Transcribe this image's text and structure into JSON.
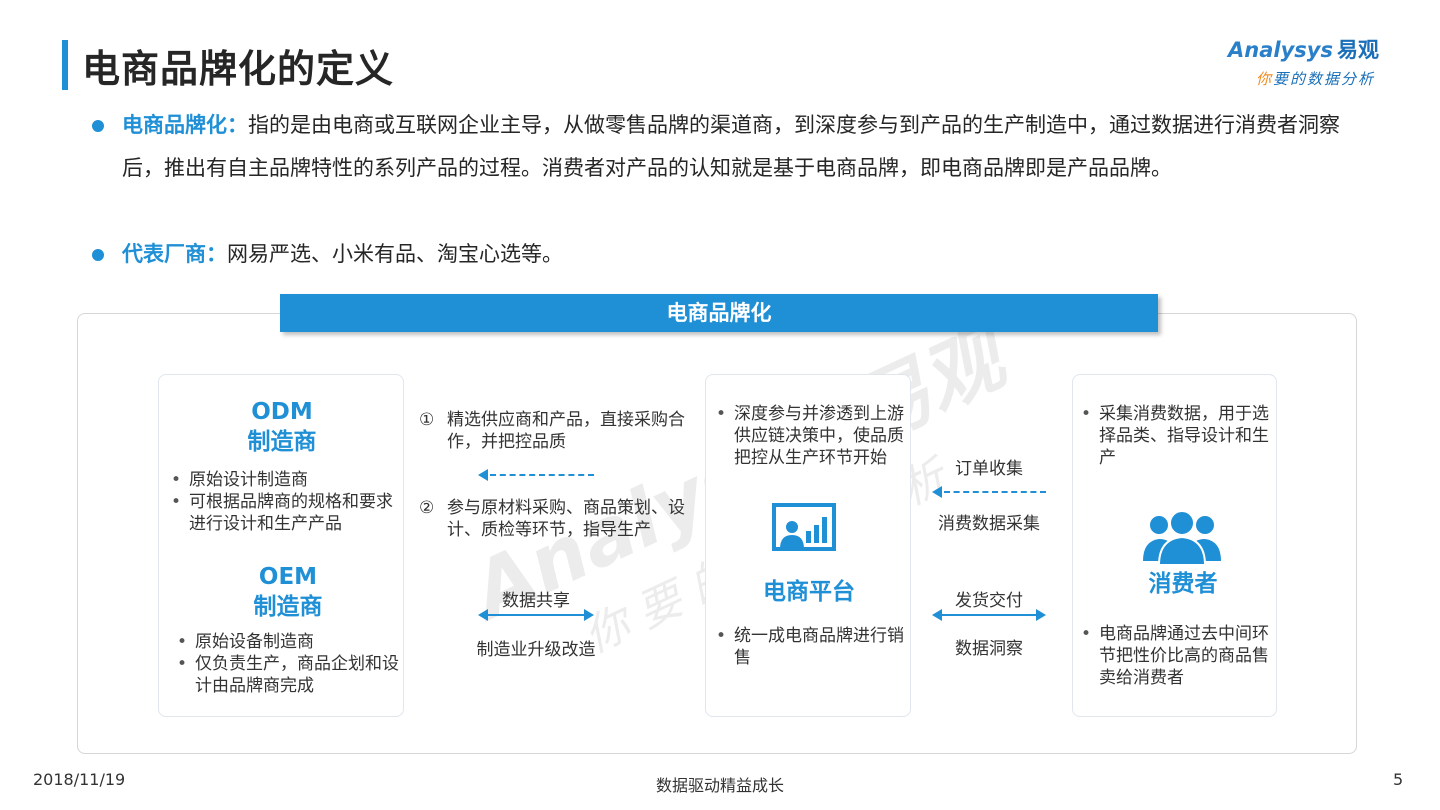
{
  "page_title": "电商品牌化的定义",
  "logo": {
    "brand_en": "Analysys",
    "brand_cn": "易观",
    "slogan_highlight": "你",
    "slogan_rest": "要的数据分析"
  },
  "bullets": [
    {
      "key": "电商品牌化：",
      "text": "指的是由电商或互联网企业主导，从做零售品牌的渠道商，到深度参与到产品的生产制造中，通过数据进行消费者洞察后，推出有自主品牌特性的系列产品的过程。消费者对产品的认知就是基于电商品牌，即电商品牌即是产品品牌。"
    },
    {
      "key": "代表厂商：",
      "text": "网易严选、小米有品、淘宝心选等。"
    }
  ],
  "banner": "电商品牌化",
  "manufacturers": {
    "odm_heading_line1": "ODM",
    "odm_heading_line2": "制造商",
    "odm_items": [
      "原始设计制造商",
      "可根据品牌商的规格和要求进行设计和生产产品"
    ],
    "oem_heading_line1": "OEM",
    "oem_heading_line2": "制造商",
    "oem_items": [
      "原始设备制造商",
      "仅负责生产，商品企划和设计由品牌商完成"
    ]
  },
  "middle_left": {
    "step1_num": "①",
    "step1_text": "精选供应商和产品，直接采购合作，并把控品质",
    "step2_num": "②",
    "step2_text": "参与原材料采购、商品策划、设计、质检等环节，指导生产",
    "shared_top": "数据共享",
    "shared_bottom": "制造业升级改造"
  },
  "platform": {
    "items_top": [
      "深度参与并渗透到上游供应链决策中，使品质把控从生产环节开始"
    ],
    "icon": "presentation-chart-icon",
    "label": "电商平台",
    "items_bottom": [
      "统一成电商品牌进行销售"
    ]
  },
  "middle_right": {
    "order_top": "订单收集",
    "order_bottom": "消费数据采集",
    "delivery_top": "发货交付",
    "delivery_bottom": "数据洞察"
  },
  "consumers": {
    "items_top": [
      "采集消费数据，用于选择品类、指导设计和生产"
    ],
    "icon": "users-group-icon",
    "label": "消费者",
    "items_bottom": [
      "电商品牌通过去中间环节把性价比高的商品售卖给消费者"
    ]
  },
  "watermark": {
    "line1": "Analysys 易观",
    "line2": "你要的数据分析"
  },
  "footer": {
    "date": "2018/11/19",
    "center": "数据驱动精益成长",
    "page": "5"
  },
  "colors": {
    "accent": "#1f8fd6",
    "text": "#262626",
    "logo_orange": "#f08a1c"
  }
}
